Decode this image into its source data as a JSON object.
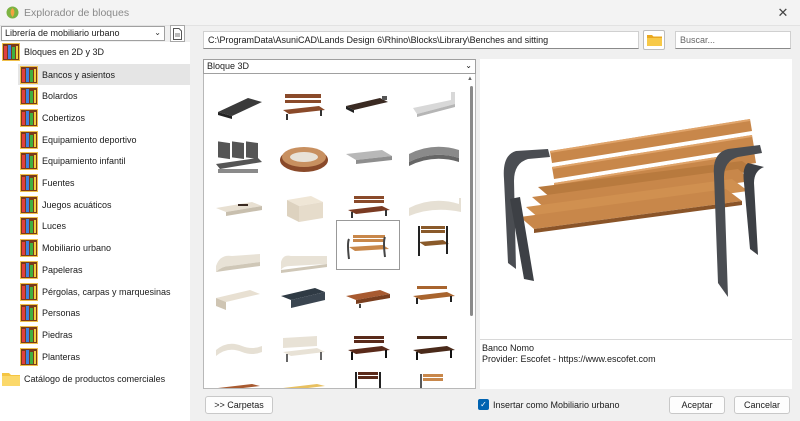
{
  "window": {
    "title": "Explorador de bloques",
    "close_icon": "close-icon"
  },
  "library": {
    "selected": "Librería de mobiliario urbano"
  },
  "tree": {
    "root": "Bloques en 2D y 3D",
    "items": [
      "Bancos y asientos",
      "Bolardos",
      "Cobertizos",
      "Equipamiento deportivo",
      "Equipamiento infantil",
      "Fuentes",
      "Juegos acuáticos",
      "Luces",
      "Mobiliario urbano",
      "Papeleras",
      "Pérgolas, carpas y marquesinas",
      "Personas",
      "Piedras",
      "Planteras"
    ],
    "selected_index": 0,
    "folder": "Catálogo de productos comerciales"
  },
  "path": "C:\\ProgramData\\AsuniCAD\\Lands Design 6\\Rhino\\Blocks\\Library\\Benches and sitting",
  "search": {
    "placeholder": "Buscar..."
  },
  "block_type": {
    "selected": "Bloque 3D"
  },
  "info": {
    "name": "Banco Nomo",
    "provider": "Provider: Escofet - https://www.escofet.com"
  },
  "buttons": {
    "folders": ">> Carpetas",
    "accept": "Aceptar",
    "cancel": "Cancelar"
  },
  "insert_checkbox": {
    "label": "Insertar como Mobiliario urbano",
    "checked": true
  },
  "colors": {
    "accent": "#0063b1",
    "wood": "#c8874a",
    "metal": "#4a4d52"
  }
}
